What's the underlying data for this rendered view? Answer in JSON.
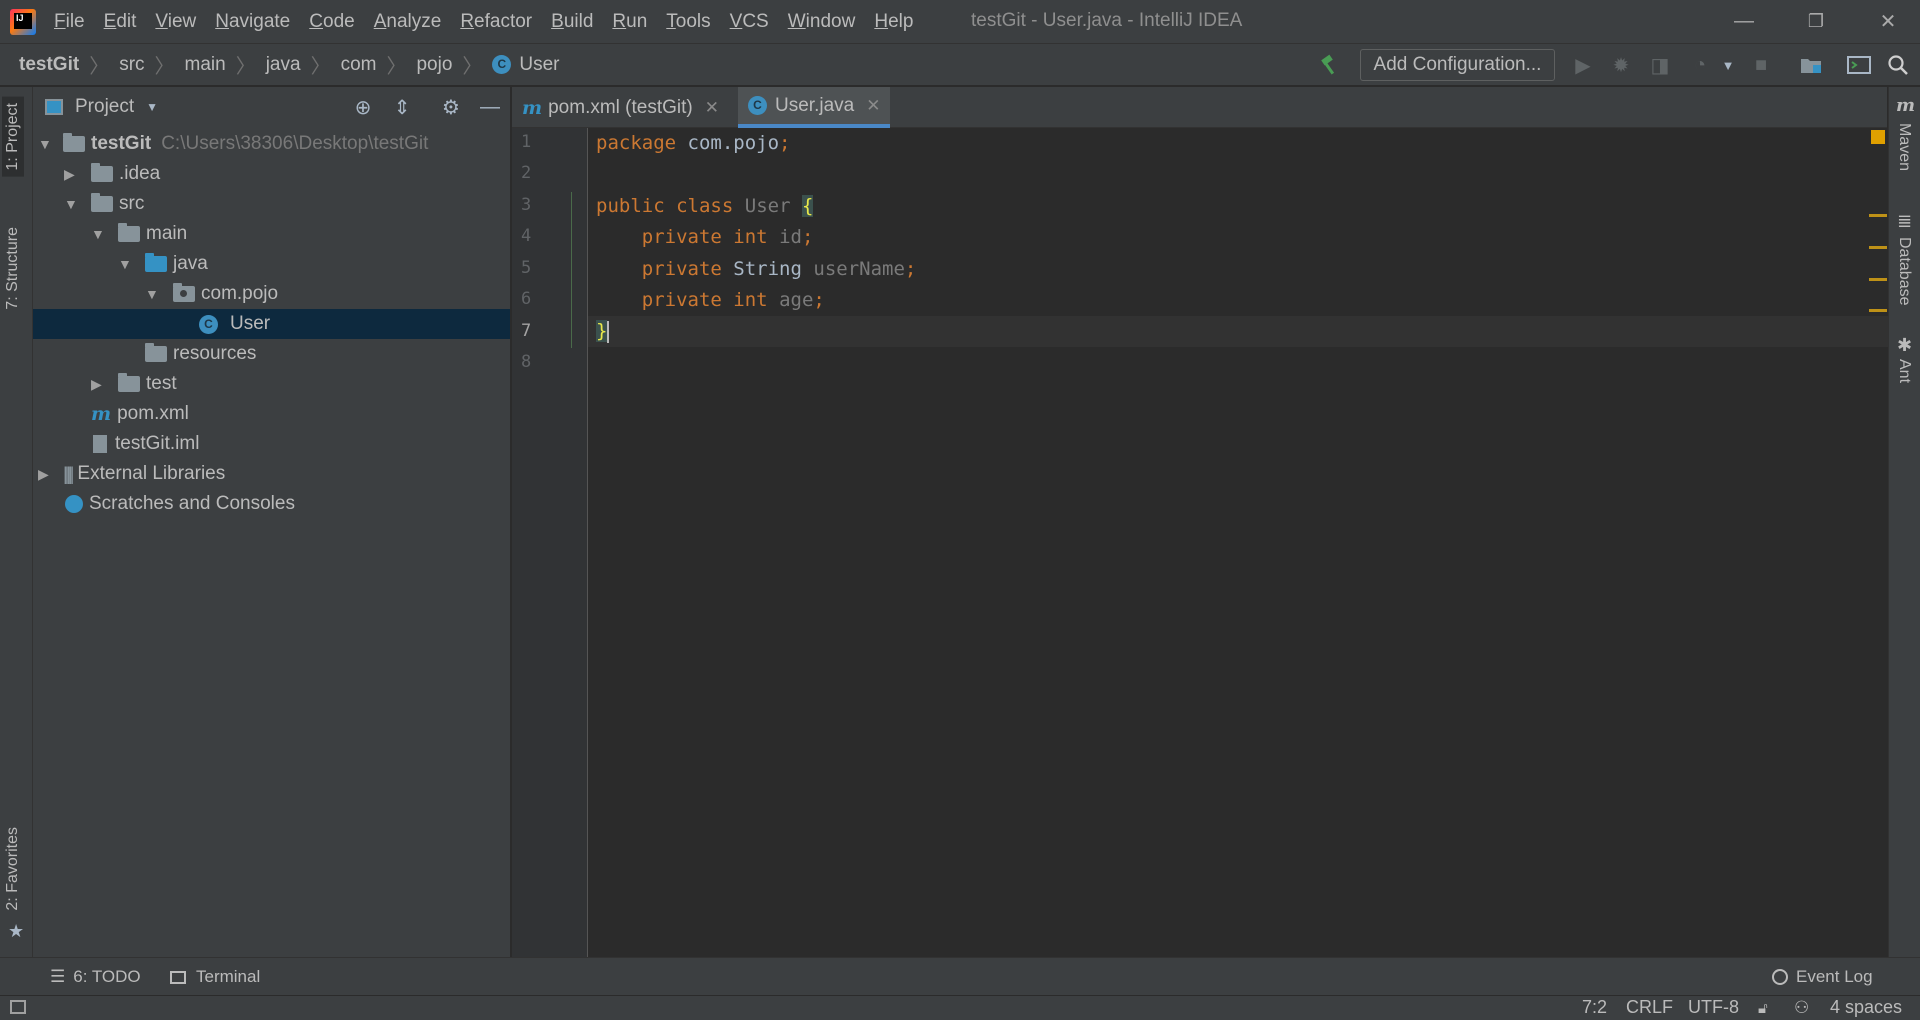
{
  "menu": [
    "File",
    "Edit",
    "View",
    "Navigate",
    "Code",
    "Analyze",
    "Refactor",
    "Build",
    "Run",
    "Tools",
    "VCS",
    "Window",
    "Help"
  ],
  "window_title": "testGit - User.java - IntelliJ IDEA",
  "window_controls": {
    "minimize": "—",
    "restore": "❐",
    "close": "✕"
  },
  "breadcrumb": [
    "testGit",
    "src",
    "main",
    "java",
    "com",
    "pojo",
    "User"
  ],
  "toolbar": {
    "add_configuration": "Add Configuration..."
  },
  "left_strip": {
    "project": "1: Project",
    "structure": "7: Structure",
    "favorites": "2: Favorites"
  },
  "project_panel": {
    "title": "Project",
    "tree": [
      {
        "label": "testGit",
        "hint": "C:\\Users\\38306\\Desktop\\testGit"
      },
      {
        "label": ".idea"
      },
      {
        "label": "src"
      },
      {
        "label": "main"
      },
      {
        "label": "java"
      },
      {
        "label": "com.pojo"
      },
      {
        "label": "User",
        "selected": true
      },
      {
        "label": "resources"
      },
      {
        "label": "test"
      },
      {
        "label": "pom.xml"
      },
      {
        "label": "testGit.iml"
      },
      {
        "label": "External Libraries"
      },
      {
        "label": "Scratches and Consoles"
      }
    ]
  },
  "editor_tabs": [
    {
      "label": "pom.xml (testGit)",
      "active": false
    },
    {
      "label": "User.java",
      "active": true
    }
  ],
  "code": {
    "line_numbers": [
      "1",
      "2",
      "3",
      "4",
      "5",
      "6",
      "7",
      "8"
    ],
    "package_kw": "package",
    "package_name": "com.pojo",
    "public_kw": "public",
    "class_kw": "class",
    "class_name": "User",
    "open_brace": "{",
    "private_kw": "private",
    "int_kw": "int",
    "string_type": "String",
    "field_id": "id",
    "field_username": "userName",
    "field_age": "age",
    "semicolon": ";",
    "close_brace": "}"
  },
  "right_strip": {
    "maven": "Maven",
    "database": "Database",
    "ant": "Ant"
  },
  "bottom_tools": {
    "todo": "6: TODO",
    "terminal": "Terminal",
    "event_log": "Event Log"
  },
  "status": {
    "position": "7:2",
    "line_sep": "CRLF",
    "encoding": "UTF-8",
    "indent": "4 spaces"
  },
  "colors": {
    "keyword": "#cc7832",
    "identifier": "#a9b7c6",
    "selection": "#0d293e",
    "accent": "#4a88c7"
  }
}
